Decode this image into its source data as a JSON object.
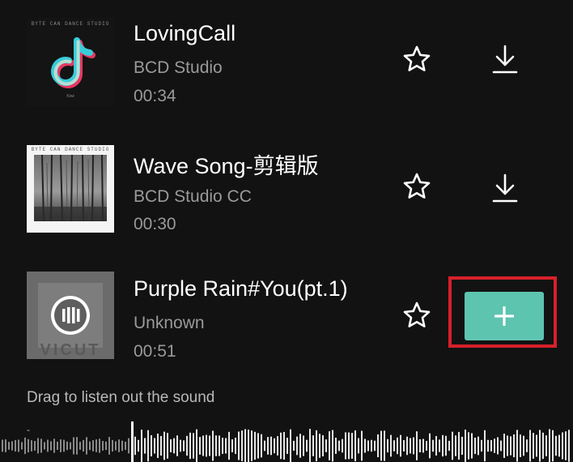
{
  "tracks": [
    {
      "title": "LovingCall",
      "artist": "BCD Studio",
      "duration": "00:34",
      "cover_text": "BYTE CAN DANCE STUDIO",
      "cover_sub": "Kiwi"
    },
    {
      "title": "Wave Song-剪辑版",
      "artist": "BCD Studio CC",
      "duration": "00:30",
      "cover_text": "BYTE CAN DANCE STUDIO"
    },
    {
      "title": "Purple Rain#You(pt.1)",
      "artist": "Unknown",
      "duration": "00:51",
      "cover_text": "VICUT"
    }
  ],
  "hint": "Drag to listen out the sound",
  "icons": {
    "favorite": "star-outline-icon",
    "download": "download-icon",
    "add": "plus-icon"
  },
  "colors": {
    "background": "#121212",
    "accent": "#5dc4b0",
    "highlight": "#d7202a"
  },
  "waveform": {
    "played_fraction": 0.23
  }
}
